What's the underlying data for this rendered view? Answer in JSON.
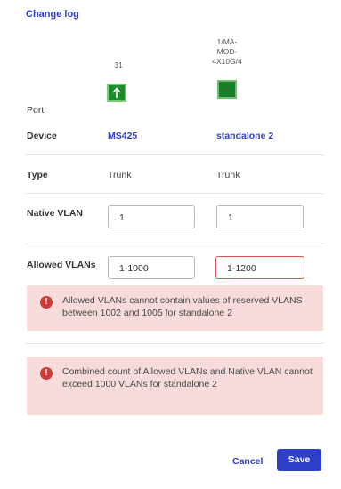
{
  "header": {
    "change_log_label": "Change log"
  },
  "ports": [
    {
      "name_lines": [
        "31"
      ],
      "icon": "uplink-port-icon"
    },
    {
      "name_lines": [
        "1/MA-",
        "MOD-",
        "4X10G/4"
      ],
      "icon": "port-icon"
    }
  ],
  "rows": {
    "port_label": "Port",
    "device_label": "Device",
    "type_label": "Type",
    "native_vlan_label": "Native VLAN",
    "allowed_vlans_label": "Allowed VLANs"
  },
  "devices": [
    "MS425",
    "standalone 2"
  ],
  "types": [
    "Trunk",
    "Trunk"
  ],
  "native_vlan": [
    "1",
    "1"
  ],
  "allowed_vlans": [
    "1-1000",
    "1-1200"
  ],
  "errors": {
    "reserved_vlans": "Allowed VLANs cannot contain values of reserved VLANS between 1002 and 1005 for standalone 2",
    "vlan_count": "Combined count of Allowed VLANs and Native VLAN cannot exceed 1000 VLANs for standalone 2"
  },
  "actions": {
    "cancel_label": "Cancel",
    "save_label": "Save"
  },
  "colors": {
    "accent": "#2d3ec9",
    "error_bg": "#f7dada",
    "error_icon": "#d13b34",
    "port_green": "#1f8a2c"
  }
}
